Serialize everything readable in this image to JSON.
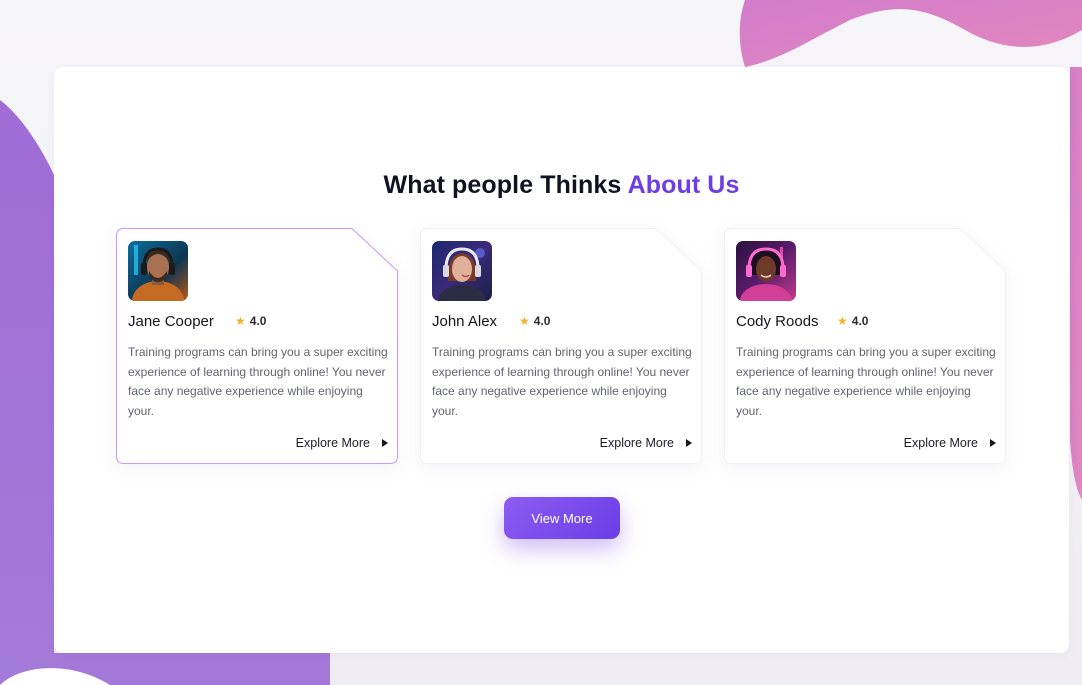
{
  "section": {
    "title_main": "What people Thinks",
    "title_accent": "About Us"
  },
  "colors": {
    "accent": "#6d3ee6",
    "button": "#7a4aee",
    "star": "#f3b32a",
    "blob_pink": "#d97fc4",
    "blob_purple": "#9a6fd8"
  },
  "testimonials": [
    {
      "name": "Jane Cooper",
      "rating": "4.0",
      "text": "Training programs can bring you a super exciting experience of learning through online! You never face any negative experience while enjoying your.",
      "link": "Explore More",
      "avatar": "man-with-headphones-avatar",
      "highlighted": true
    },
    {
      "name": "John Alex",
      "rating": "4.0",
      "text": "Training programs can bring you a super exciting experience of learning through online! You never face any negative experience while enjoying your.",
      "link": "Explore More",
      "avatar": "woman-with-headphones-avatar",
      "highlighted": false
    },
    {
      "name": "Cody Roods",
      "rating": "4.0",
      "text": "Training programs can bring you a super exciting experience of learning through online! You never face any negative experience while enjoying your.",
      "link": "Explore More",
      "avatar": "woman-gamer-avatar",
      "highlighted": false
    }
  ],
  "cta": {
    "label": "View More"
  },
  "icons": {
    "rating": "star-icon",
    "explore": "play-icon"
  }
}
